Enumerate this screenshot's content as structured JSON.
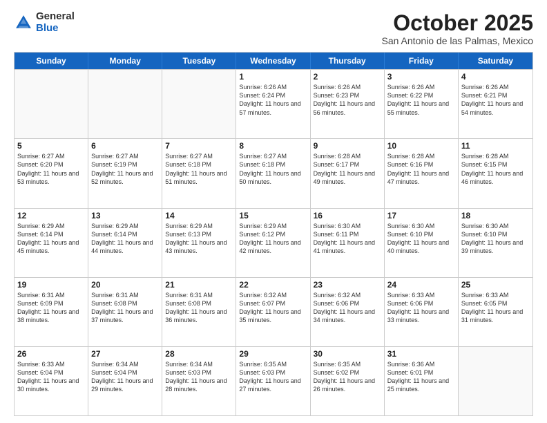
{
  "logo": {
    "general": "General",
    "blue": "Blue"
  },
  "header": {
    "month": "October 2025",
    "location": "San Antonio de las Palmas, Mexico"
  },
  "weekdays": [
    "Sunday",
    "Monday",
    "Tuesday",
    "Wednesday",
    "Thursday",
    "Friday",
    "Saturday"
  ],
  "weeks": [
    [
      {
        "day": "",
        "info": ""
      },
      {
        "day": "",
        "info": ""
      },
      {
        "day": "",
        "info": ""
      },
      {
        "day": "1",
        "info": "Sunrise: 6:26 AM\nSunset: 6:24 PM\nDaylight: 11 hours and 57 minutes."
      },
      {
        "day": "2",
        "info": "Sunrise: 6:26 AM\nSunset: 6:23 PM\nDaylight: 11 hours and 56 minutes."
      },
      {
        "day": "3",
        "info": "Sunrise: 6:26 AM\nSunset: 6:22 PM\nDaylight: 11 hours and 55 minutes."
      },
      {
        "day": "4",
        "info": "Sunrise: 6:26 AM\nSunset: 6:21 PM\nDaylight: 11 hours and 54 minutes."
      }
    ],
    [
      {
        "day": "5",
        "info": "Sunrise: 6:27 AM\nSunset: 6:20 PM\nDaylight: 11 hours and 53 minutes."
      },
      {
        "day": "6",
        "info": "Sunrise: 6:27 AM\nSunset: 6:19 PM\nDaylight: 11 hours and 52 minutes."
      },
      {
        "day": "7",
        "info": "Sunrise: 6:27 AM\nSunset: 6:18 PM\nDaylight: 11 hours and 51 minutes."
      },
      {
        "day": "8",
        "info": "Sunrise: 6:27 AM\nSunset: 6:18 PM\nDaylight: 11 hours and 50 minutes."
      },
      {
        "day": "9",
        "info": "Sunrise: 6:28 AM\nSunset: 6:17 PM\nDaylight: 11 hours and 49 minutes."
      },
      {
        "day": "10",
        "info": "Sunrise: 6:28 AM\nSunset: 6:16 PM\nDaylight: 11 hours and 47 minutes."
      },
      {
        "day": "11",
        "info": "Sunrise: 6:28 AM\nSunset: 6:15 PM\nDaylight: 11 hours and 46 minutes."
      }
    ],
    [
      {
        "day": "12",
        "info": "Sunrise: 6:29 AM\nSunset: 6:14 PM\nDaylight: 11 hours and 45 minutes."
      },
      {
        "day": "13",
        "info": "Sunrise: 6:29 AM\nSunset: 6:14 PM\nDaylight: 11 hours and 44 minutes."
      },
      {
        "day": "14",
        "info": "Sunrise: 6:29 AM\nSunset: 6:13 PM\nDaylight: 11 hours and 43 minutes."
      },
      {
        "day": "15",
        "info": "Sunrise: 6:29 AM\nSunset: 6:12 PM\nDaylight: 11 hours and 42 minutes."
      },
      {
        "day": "16",
        "info": "Sunrise: 6:30 AM\nSunset: 6:11 PM\nDaylight: 11 hours and 41 minutes."
      },
      {
        "day": "17",
        "info": "Sunrise: 6:30 AM\nSunset: 6:10 PM\nDaylight: 11 hours and 40 minutes."
      },
      {
        "day": "18",
        "info": "Sunrise: 6:30 AM\nSunset: 6:10 PM\nDaylight: 11 hours and 39 minutes."
      }
    ],
    [
      {
        "day": "19",
        "info": "Sunrise: 6:31 AM\nSunset: 6:09 PM\nDaylight: 11 hours and 38 minutes."
      },
      {
        "day": "20",
        "info": "Sunrise: 6:31 AM\nSunset: 6:08 PM\nDaylight: 11 hours and 37 minutes."
      },
      {
        "day": "21",
        "info": "Sunrise: 6:31 AM\nSunset: 6:08 PM\nDaylight: 11 hours and 36 minutes."
      },
      {
        "day": "22",
        "info": "Sunrise: 6:32 AM\nSunset: 6:07 PM\nDaylight: 11 hours and 35 minutes."
      },
      {
        "day": "23",
        "info": "Sunrise: 6:32 AM\nSunset: 6:06 PM\nDaylight: 11 hours and 34 minutes."
      },
      {
        "day": "24",
        "info": "Sunrise: 6:33 AM\nSunset: 6:06 PM\nDaylight: 11 hours and 33 minutes."
      },
      {
        "day": "25",
        "info": "Sunrise: 6:33 AM\nSunset: 6:05 PM\nDaylight: 11 hours and 31 minutes."
      }
    ],
    [
      {
        "day": "26",
        "info": "Sunrise: 6:33 AM\nSunset: 6:04 PM\nDaylight: 11 hours and 30 minutes."
      },
      {
        "day": "27",
        "info": "Sunrise: 6:34 AM\nSunset: 6:04 PM\nDaylight: 11 hours and 29 minutes."
      },
      {
        "day": "28",
        "info": "Sunrise: 6:34 AM\nSunset: 6:03 PM\nDaylight: 11 hours and 28 minutes."
      },
      {
        "day": "29",
        "info": "Sunrise: 6:35 AM\nSunset: 6:03 PM\nDaylight: 11 hours and 27 minutes."
      },
      {
        "day": "30",
        "info": "Sunrise: 6:35 AM\nSunset: 6:02 PM\nDaylight: 11 hours and 26 minutes."
      },
      {
        "day": "31",
        "info": "Sunrise: 6:36 AM\nSunset: 6:01 PM\nDaylight: 11 hours and 25 minutes."
      },
      {
        "day": "",
        "info": ""
      }
    ]
  ]
}
